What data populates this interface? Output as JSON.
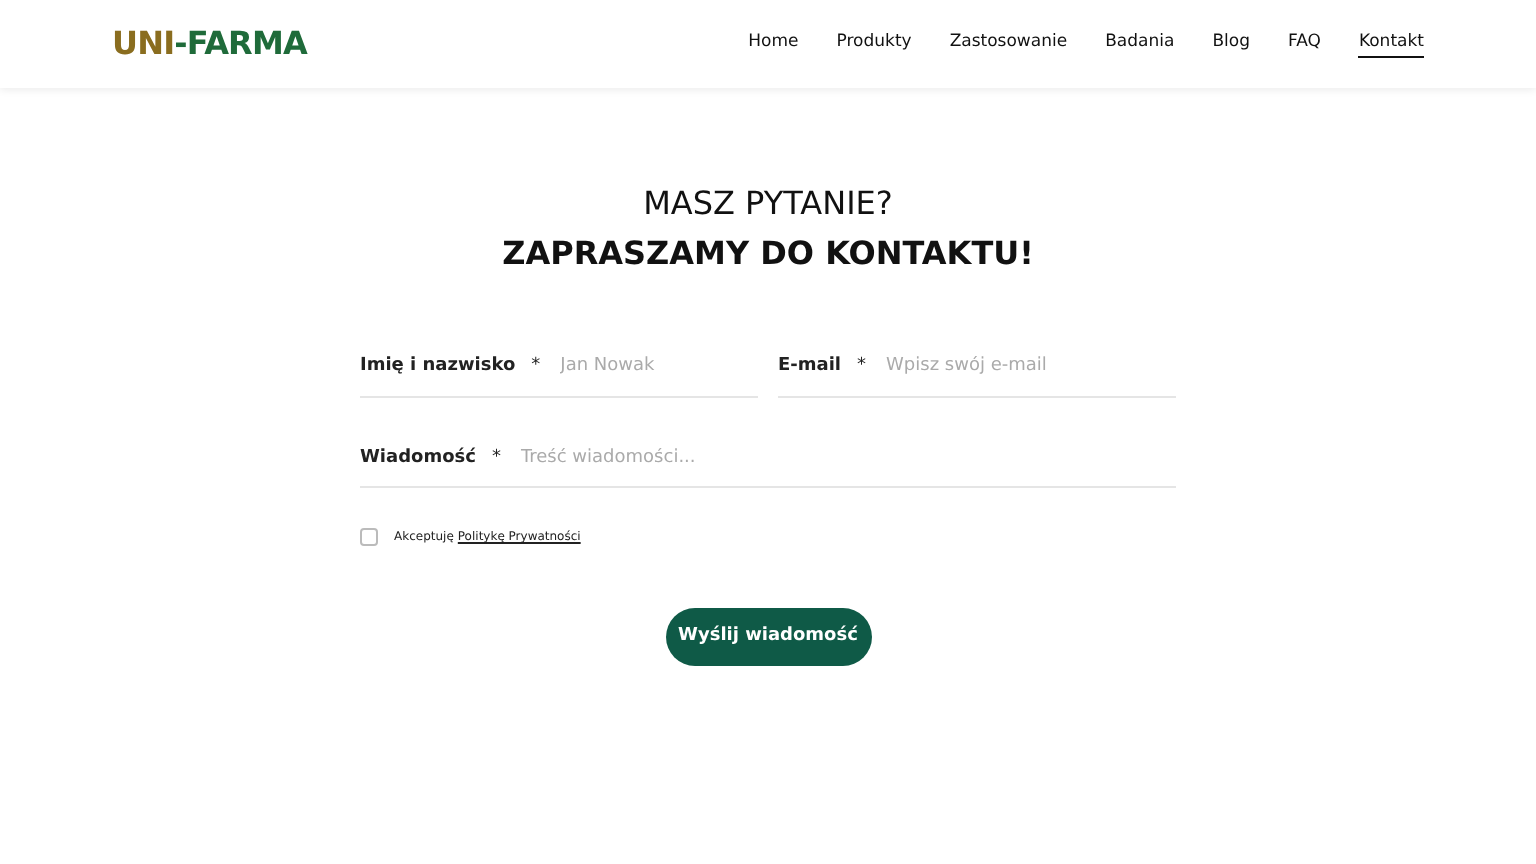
{
  "logo": {
    "part_1": "UNI",
    "part_2": "-FARMA"
  },
  "nav": [
    {
      "label": "Home",
      "selected": false
    },
    {
      "label": "Produkty",
      "selected": false
    },
    {
      "label": "Zastosowanie",
      "selected": false
    },
    {
      "label": "Badania",
      "selected": false
    },
    {
      "label": "Blog",
      "selected": false
    },
    {
      "label": "FAQ",
      "selected": false
    },
    {
      "label": "Kontakt",
      "selected": true
    }
  ],
  "heading": {
    "line_1": "MASZ PYTANIE?",
    "line_2": "ZAPRASZAMY DO KONTAKTU!"
  },
  "form": {
    "name": {
      "label": "Imię i nazwisko",
      "required": "*",
      "placeholder": "Jan Nowak"
    },
    "email": {
      "label": "E-mail",
      "required": "*",
      "placeholder": "Wpisz swój e-mail"
    },
    "message": {
      "label": "Wiadomość",
      "required": "*",
      "placeholder": "Treść wiadomości..."
    },
    "consent": {
      "text": "Akceptuję",
      "link": "Politykę Prywatności",
      "checked": false
    },
    "submit": "Wyślij wiadomość"
  }
}
